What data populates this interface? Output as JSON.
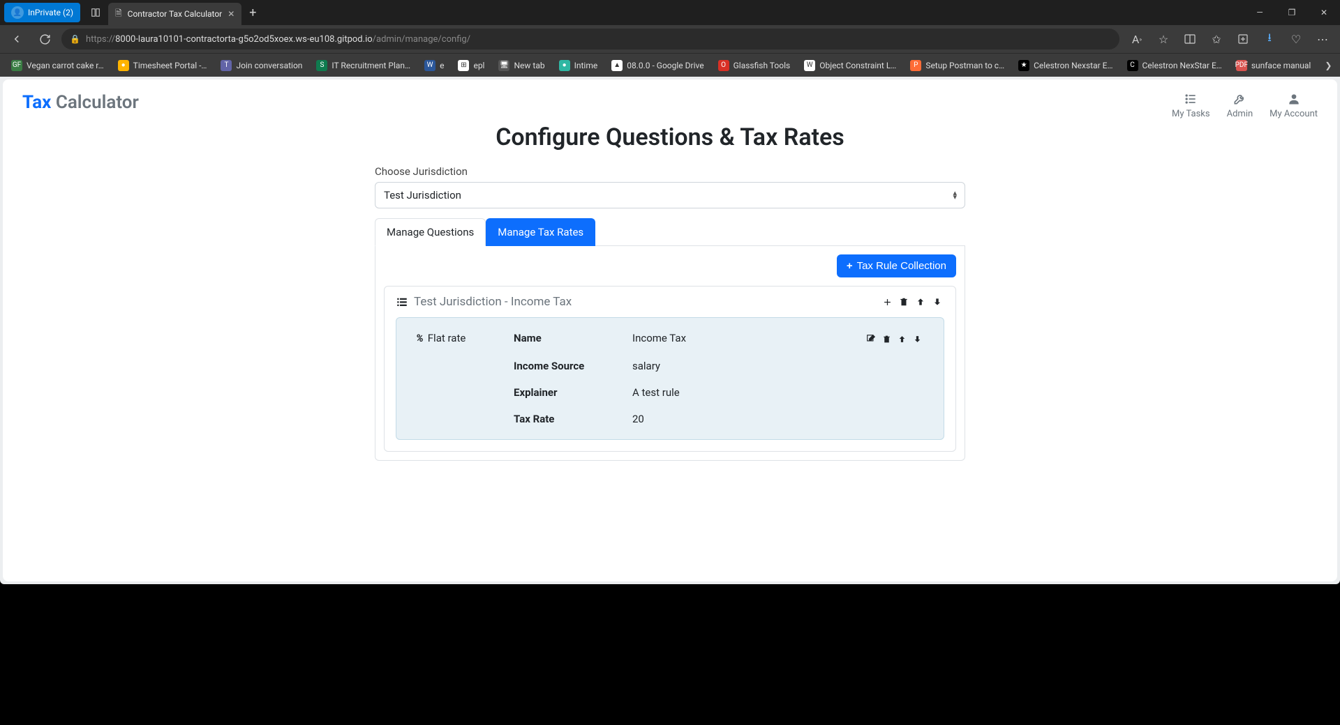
{
  "browser": {
    "inprivate_label": "InPrivate (2)",
    "tab_title": "Contractor Tax Calculator",
    "url_prefix": "https://",
    "url_host": "8000-laura10101-contractorta-g5o2od5xoex.ws-eu108.gitpod.io",
    "url_path": "/admin/manage/config/",
    "bookmarks": [
      {
        "label": "Vegan carrot cake r…",
        "fav_bg": "#3a7d44",
        "fav_text": "GF"
      },
      {
        "label": "Timesheet Portal -…",
        "fav_bg": "#ffb400",
        "fav_text": "●"
      },
      {
        "label": "Join conversation",
        "fav_bg": "#6264a7",
        "fav_text": "T"
      },
      {
        "label": "IT Recruitment Plan…",
        "fav_bg": "#0f7b4f",
        "fav_text": "S"
      },
      {
        "label": "e",
        "fav_bg": "#2b579a",
        "fav_text": "W"
      },
      {
        "label": "epl",
        "fav_bg": "#ffffff",
        "fav_text": "⊞"
      },
      {
        "label": "New tab",
        "fav_bg": "#555",
        "fav_text": "🖥"
      },
      {
        "label": "Intime",
        "fav_bg": "#2fb7a3",
        "fav_text": "●"
      },
      {
        "label": "08.0.0 - Google Drive",
        "fav_bg": "#ffffff",
        "fav_text": "▲"
      },
      {
        "label": "Glassfish Tools",
        "fav_bg": "#d93025",
        "fav_text": "O"
      },
      {
        "label": "Object Constraint L…",
        "fav_bg": "#ffffff",
        "fav_text": "W"
      },
      {
        "label": "Setup Postman to c…",
        "fav_bg": "#ff6c37",
        "fav_text": "P"
      },
      {
        "label": "Celestron Nexstar E…",
        "fav_bg": "#000000",
        "fav_text": "★"
      },
      {
        "label": "Celestron NexStar E…",
        "fav_bg": "#000000",
        "fav_text": "C"
      },
      {
        "label": "sunface manual",
        "fav_bg": "#d9534f",
        "fav_text": "PDF"
      }
    ]
  },
  "app": {
    "logo_tax": "Tax",
    "logo_calc": "Calculator",
    "nav": [
      {
        "label": "My Tasks",
        "icon": "list-icon"
      },
      {
        "label": "Admin",
        "icon": "tools-icon"
      },
      {
        "label": "My Account",
        "icon": "user-icon"
      }
    ],
    "title": "Configure Questions & Tax Rates",
    "jurisdiction_label": "Choose Jurisdiction",
    "jurisdiction_value": "Test Jurisdiction",
    "tabs": {
      "manage_questions": "Manage Questions",
      "manage_tax_rates": "Manage Tax Rates"
    },
    "add_collection_label": "Tax Rule Collection",
    "collection": {
      "title": "Test Jurisdiction - Income Tax",
      "rule": {
        "type_label": "Flat rate",
        "name_label": "Name",
        "name_value": "Income Tax",
        "source_label": "Income Source",
        "source_value": "salary",
        "explainer_label": "Explainer",
        "explainer_value": "A test rule",
        "rate_label": "Tax Rate",
        "rate_value": "20"
      }
    }
  }
}
